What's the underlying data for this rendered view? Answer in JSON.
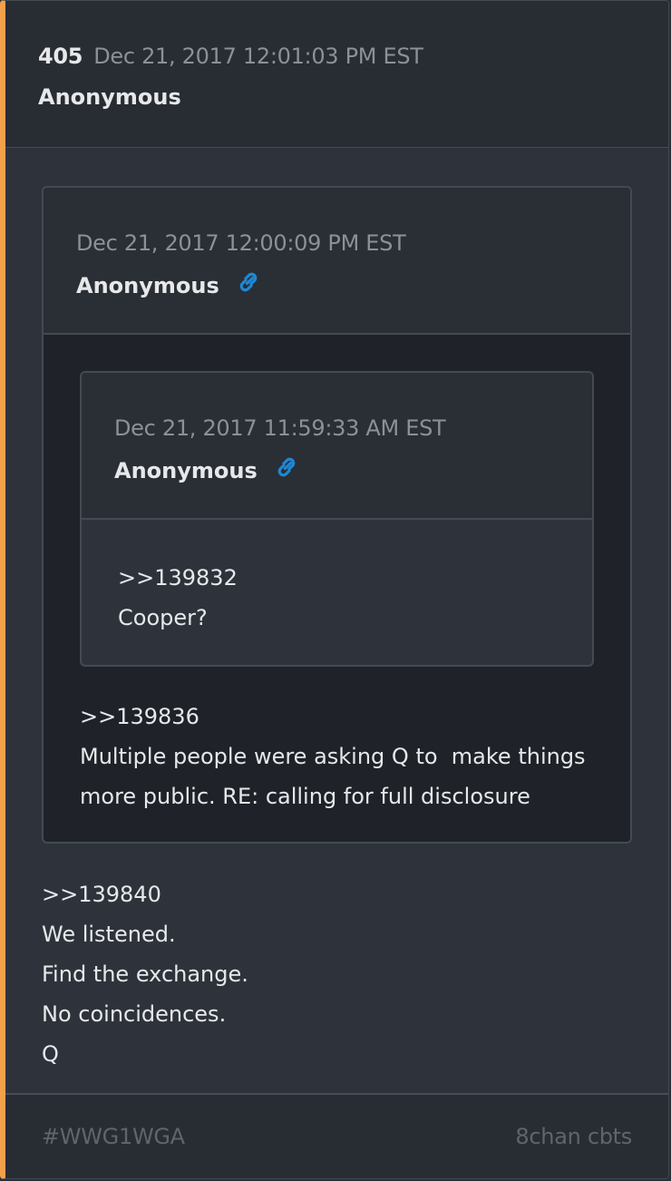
{
  "post": {
    "number": "405",
    "timestamp": "Dec 21, 2017 12:01:03 PM EST",
    "author": "Anonymous",
    "lines": [
      ">>139840",
      "We listened.",
      "Find the exchange.",
      "No coincidences.",
      "Q"
    ]
  },
  "quote_outer": {
    "timestamp": "Dec 21, 2017 12:00:09 PM EST",
    "author": "Anonymous",
    "link_icon": "link-icon",
    "lines": [
      ">>139836",
      "Multiple people were asking Q to  make things",
      "more public. RE: calling for full disclosure"
    ]
  },
  "quote_inner": {
    "timestamp": "Dec 21, 2017 11:59:33 AM EST",
    "author": "Anonymous",
    "link_icon": "link-icon",
    "lines": [
      ">>139832",
      "Cooper?"
    ]
  },
  "footer": {
    "tag": "#WWG1WGA",
    "source": "8chan cbts"
  },
  "colors": {
    "accent": "#f3a04c",
    "link": "#1e88d4",
    "text": "#e6e8ea",
    "muted": "#8b9199"
  }
}
